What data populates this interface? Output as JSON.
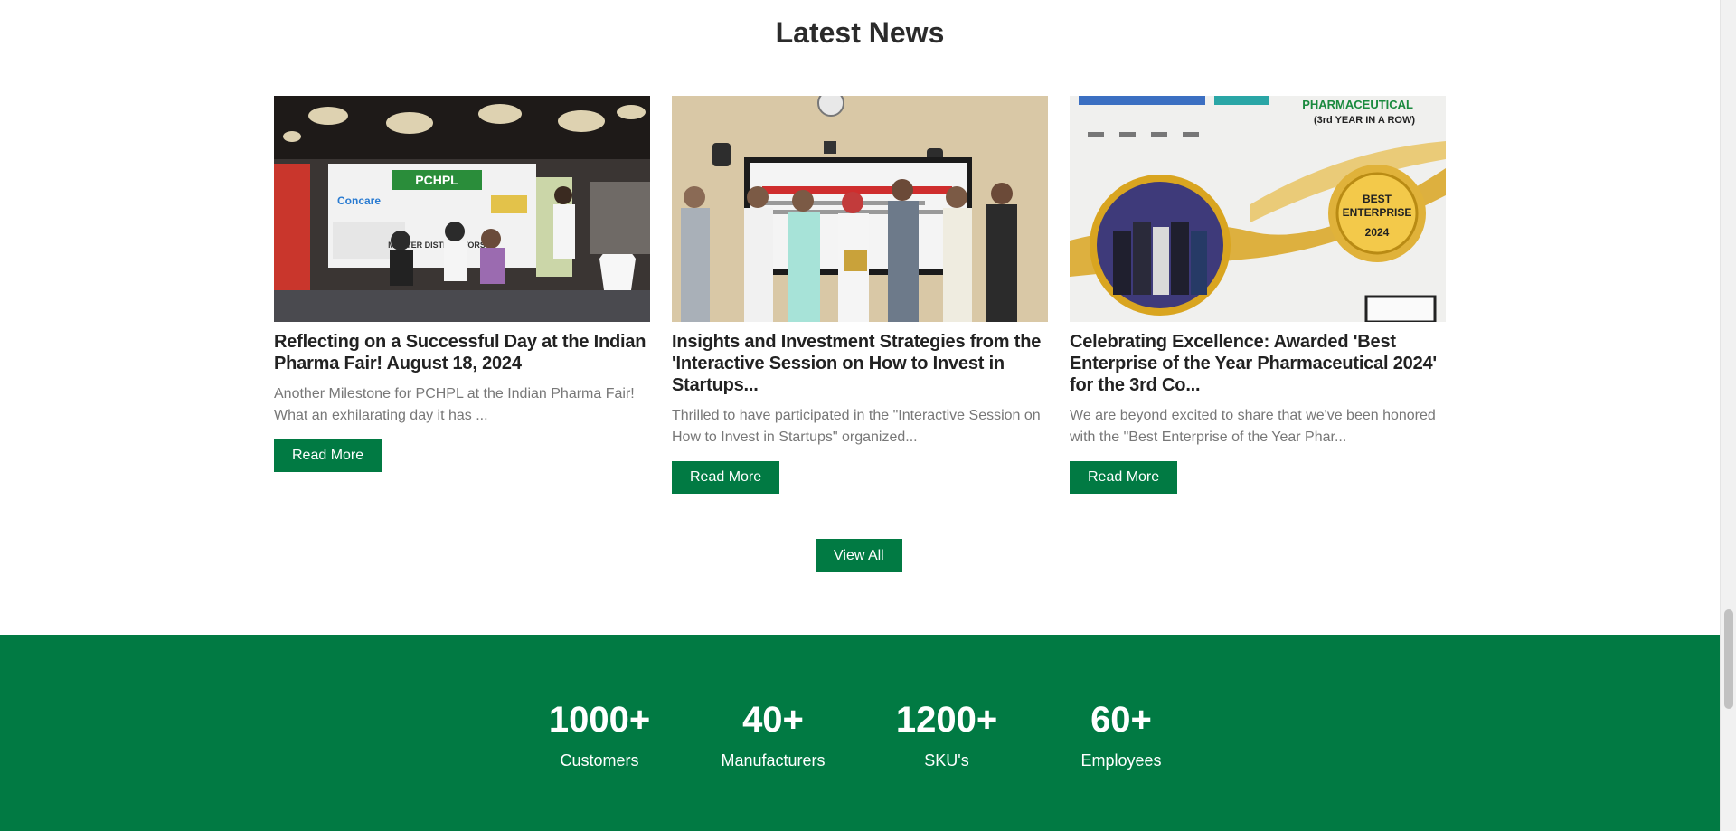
{
  "section": {
    "title": "Latest News"
  },
  "news": [
    {
      "title": "Reflecting on a Successful Day at the Indian Pharma Fair! August 18, 2024",
      "excerpt": "Another Milestone for PCHPL at the Indian Pharma Fair! What an exhilarating day it has ...",
      "button": "Read More",
      "image": {
        "banner_text": "PCHPL",
        "brand_text": "Concare",
        "sub_text": "MASTER DISTRIBUTORS"
      }
    },
    {
      "title": "Insights and Investment Strategies from the 'Interactive Session on How to Invest in Startups...",
      "excerpt": "Thrilled to have participated in the \"Interactive Session on How to Invest in Startups\" organized...",
      "button": "Read More",
      "image": {}
    },
    {
      "title": "Celebrating Excellence: Awarded 'Best Enterprise of the Year Pharmaceutical 2024' for the 3rd Co...",
      "excerpt": "We are beyond excited to share that we've been honored with the \"Best Enterprise of the Year Phar...",
      "button": "Read More",
      "image": {
        "heading": "PHARMACEUTICAL",
        "subheading": "(3rd YEAR IN A ROW)",
        "badge_line1": "BEST",
        "badge_line2": "ENTERPRISE",
        "badge_year": "2024"
      }
    }
  ],
  "view_all": "View All",
  "stats": [
    {
      "value": "1000+",
      "label": "Customers"
    },
    {
      "value": "40+",
      "label": "Manufacturers"
    },
    {
      "value": "1200+",
      "label": "SKU's"
    },
    {
      "value": "60+",
      "label": "Employees"
    }
  ],
  "colors": {
    "brand_green": "#017a43",
    "title": "#2b2b2b",
    "excerpt": "#777777",
    "gold": "#d9a520"
  }
}
